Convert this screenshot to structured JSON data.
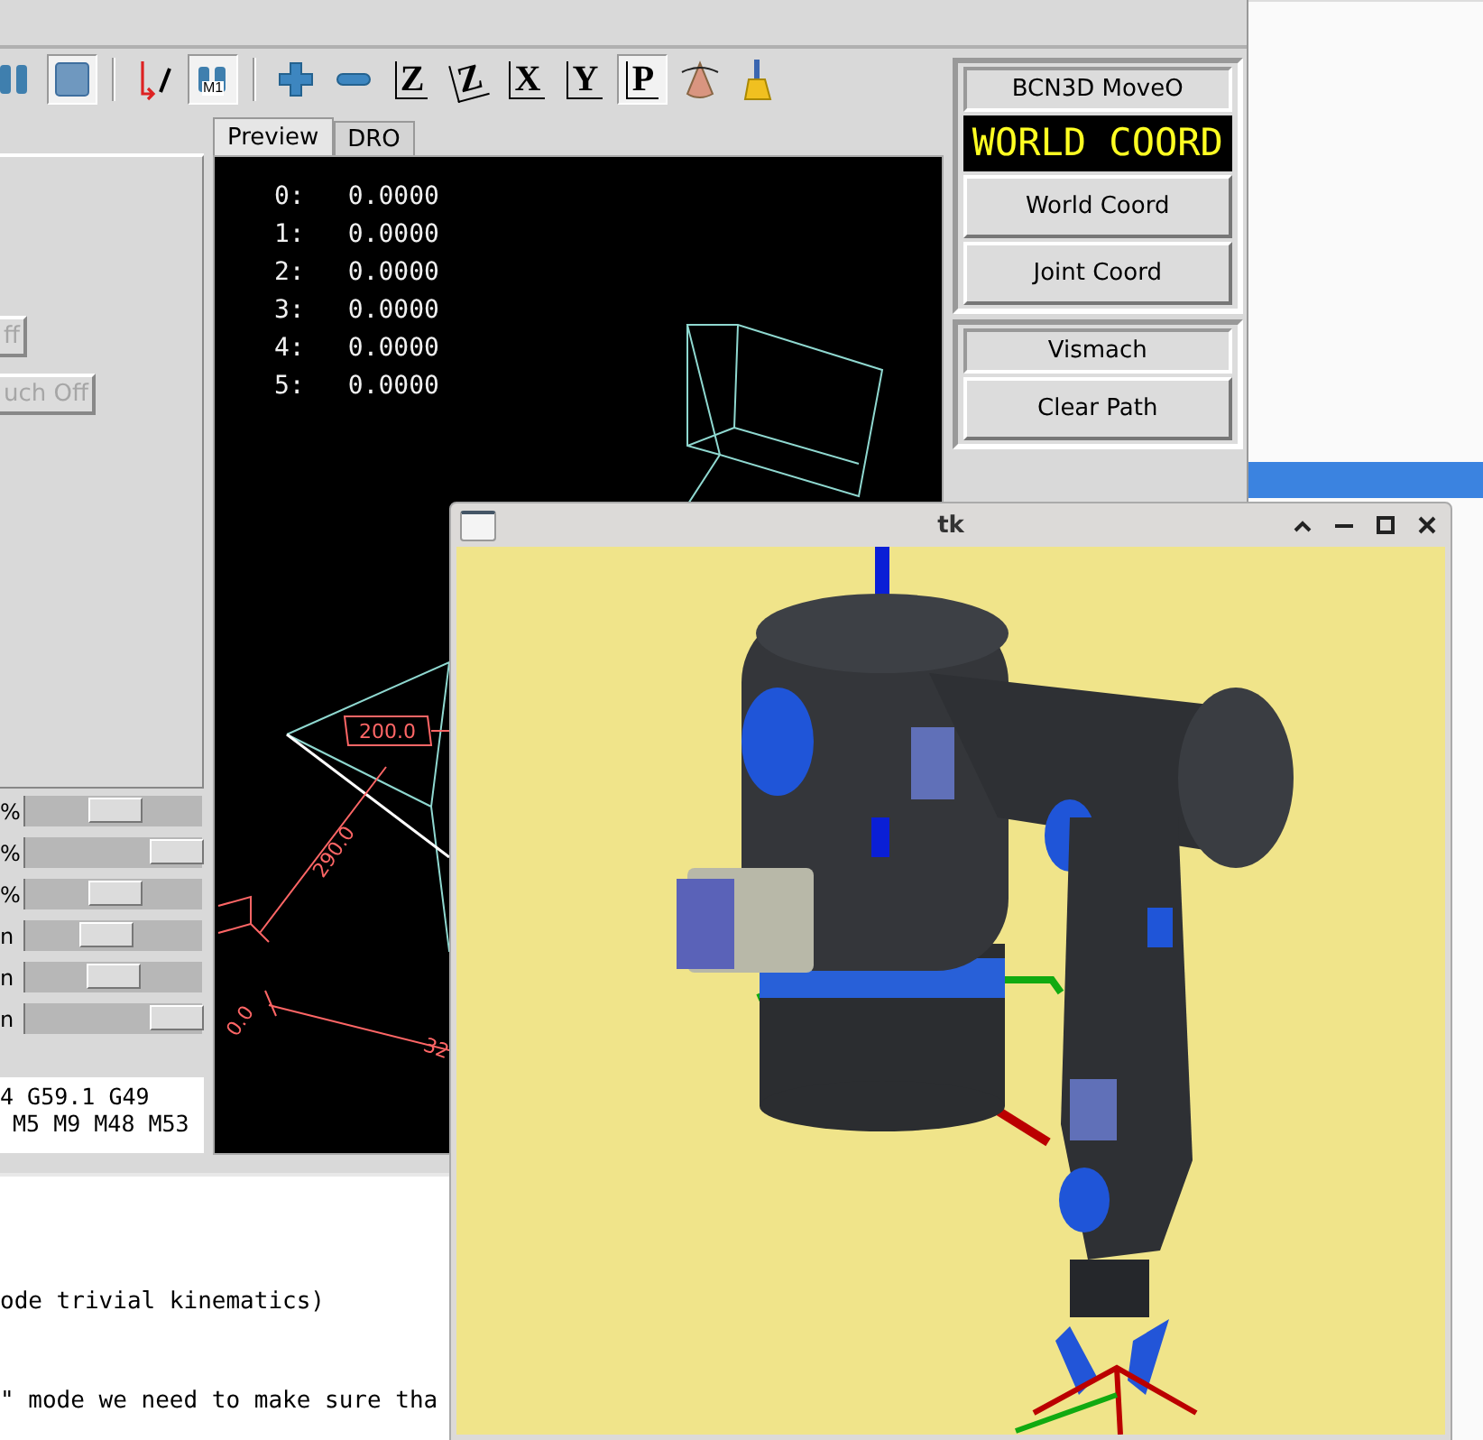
{
  "main_window": {
    "toolbar": [
      {
        "kind": "bars",
        "selected": false
      },
      {
        "kind": "square",
        "selected": true
      },
      {
        "kind": "arrow",
        "selected": false
      },
      {
        "kind": "m1",
        "label": "M1",
        "selected": true
      },
      {
        "kind": "plus",
        "selected": false
      },
      {
        "kind": "minus",
        "selected": false
      },
      {
        "kind": "letter",
        "label": "Z",
        "selected": false
      },
      {
        "kind": "letter_rot",
        "label": "Z",
        "selected": false
      },
      {
        "kind": "letter",
        "label": "X",
        "selected": false
      },
      {
        "kind": "letter",
        "label": "Y",
        "selected": false
      },
      {
        "kind": "letter",
        "label": "P",
        "selected": true
      },
      {
        "kind": "cone",
        "selected": false
      },
      {
        "kind": "brush",
        "selected": false
      }
    ],
    "left_panel": {
      "buttons": [
        {
          "label": "ff",
          "disabled": true
        },
        {
          "label": "uch Off",
          "disabled": true
        }
      ],
      "sliders": [
        {
          "label": "%",
          "level": 0.5
        },
        {
          "label": "%",
          "level": 1.0
        },
        {
          "label": "%",
          "level": 0.5
        },
        {
          "label": "n",
          "level": 0.43
        },
        {
          "label": "n",
          "level": 0.49
        },
        {
          "label": "n",
          "level": 1.0
        }
      ],
      "gcodes": [
        "4 G59.1 G49",
        "M5 M9 M48 M53"
      ]
    },
    "tabs": [
      {
        "label": "Preview",
        "selected": true
      },
      {
        "label": "DRO",
        "selected": false
      }
    ],
    "dro": [
      {
        "axis": "0:",
        "value": "0.0000"
      },
      {
        "axis": "1:",
        "value": "0.0000"
      },
      {
        "axis": "2:",
        "value": "0.0000"
      },
      {
        "axis": "3:",
        "value": "0.0000"
      },
      {
        "axis": "4:",
        "value": "0.0000"
      },
      {
        "axis": "5:",
        "value": "0.0000"
      }
    ],
    "preview_labels": [
      "200.0",
      "290.0",
      "0.0",
      "32"
    ],
    "right_panel": {
      "title": "BCN3D MoveO",
      "mode_display": "WORLD COORD",
      "mode_buttons": [
        "World Coord",
        "Joint Coord"
      ],
      "vismach_title": "Vismach",
      "vismach_buttons": [
        "Clear Path"
      ]
    }
  },
  "editor": {
    "lines": [
      "ode trivial kinematics)",
      "\" mode we need to make sure tha"
    ]
  },
  "tk_window": {
    "title": "tk"
  }
}
